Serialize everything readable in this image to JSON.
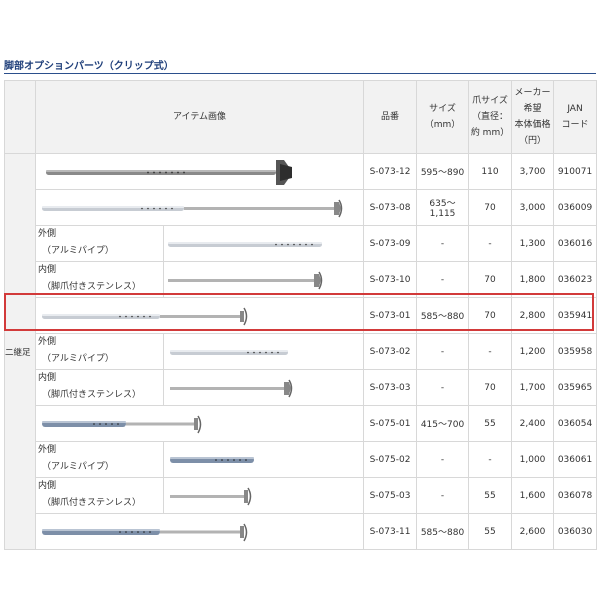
{
  "page_title": "脚部オプションパーツ（クリップ式）",
  "headers": {
    "image": "アイテム画像",
    "part_no": "品番",
    "size_line1": "サイズ",
    "size_line2": "（mm）",
    "claw_line1": "爪サイズ",
    "claw_line2": "（直径：",
    "claw_line3": "約 mm）",
    "price_line1": "メーカー",
    "price_line2": "希望",
    "price_line3": "本体価格",
    "price_line4": "（円）",
    "jan_line1": "JAN",
    "jan_line2": "コード"
  },
  "group_label": "二継足",
  "highlight_color": "#d23a3a",
  "rows": [
    {
      "part_no": "S-073-12",
      "size": "595〜890",
      "claw": "110",
      "price": "3,700",
      "jan": "910071"
    },
    {
      "part_no": "S-073-08",
      "size": "635〜1,115",
      "claw": "70",
      "price": "3,000",
      "jan": "036009"
    },
    {
      "sub_line1": "外側",
      "sub_line2": "（アルミパイプ）",
      "part_no": "S-073-09",
      "size": "-",
      "claw": "-",
      "price": "1,300",
      "jan": "036016"
    },
    {
      "sub_line1": "内側",
      "sub_line2": "（脚爪付きステンレス）",
      "part_no": "S-073-10",
      "size": "-",
      "claw": "70",
      "price": "1,800",
      "jan": "036023"
    },
    {
      "part_no": "S-073-01",
      "size": "585〜880",
      "claw": "70",
      "price": "2,800",
      "jan": "035941"
    },
    {
      "sub_line1": "外側",
      "sub_line2": "（アルミパイプ）",
      "part_no": "S-073-02",
      "size": "-",
      "claw": "-",
      "price": "1,200",
      "jan": "035958"
    },
    {
      "sub_line1": "内側",
      "sub_line2": "（脚爪付きステンレス）",
      "part_no": "S-073-03",
      "size": "-",
      "claw": "70",
      "price": "1,700",
      "jan": "035965"
    },
    {
      "part_no": "S-075-01",
      "size": "415〜700",
      "claw": "55",
      "price": "2,400",
      "jan": "036054"
    },
    {
      "sub_line1": "外側",
      "sub_line2": "（アルミパイプ）",
      "part_no": "S-075-02",
      "size": "-",
      "claw": "-",
      "price": "1,000",
      "jan": "036061"
    },
    {
      "sub_line1": "内側",
      "sub_line2": "（脚爪付きステンレス）",
      "part_no": "S-075-03",
      "size": "-",
      "claw": "55",
      "price": "1,600",
      "jan": "036078"
    },
    {
      "part_no": "S-073-11",
      "size": "585〜880",
      "claw": "55",
      "price": "2,600",
      "jan": "036030"
    }
  ]
}
